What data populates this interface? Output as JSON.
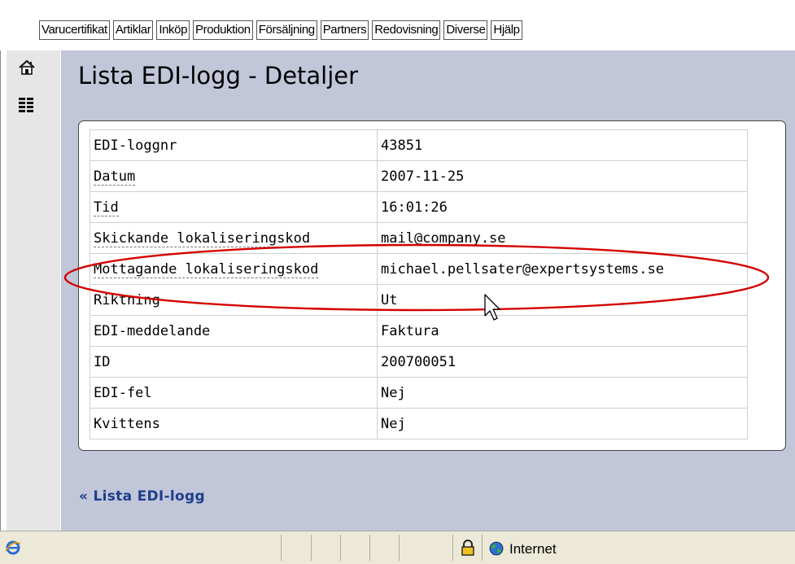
{
  "menu": {
    "items": [
      "Varucertifikat",
      "Artiklar",
      "Inköp",
      "Produktion",
      "Försäljning",
      "Partners",
      "Redovisning",
      "Diverse",
      "Hjälp"
    ]
  },
  "page": {
    "title": "Lista EDI-logg - Detaljer"
  },
  "details": {
    "rows": [
      {
        "label": "EDI-loggnr",
        "value": "43851"
      },
      {
        "label": "Datum",
        "value": "2007-11-25"
      },
      {
        "label": "Tid",
        "value": "16:01:26"
      },
      {
        "label": "Skickande lokaliseringskod",
        "value": "mail@company.se"
      },
      {
        "label": "Mottagande lokaliseringskod",
        "value": "michael.pellsater@expertsystems.se"
      },
      {
        "label": "Riktning",
        "value": "Ut"
      },
      {
        "label": "EDI-meddelande",
        "value": "Faktura"
      },
      {
        "label": "ID",
        "value": "200700051"
      },
      {
        "label": "EDI-fel",
        "value": "Nej"
      },
      {
        "label": "Kvittens",
        "value": "Nej"
      }
    ]
  },
  "back_link": {
    "label": "« Lista EDI-logg"
  },
  "statusbar": {
    "zone": "Internet"
  },
  "colors": {
    "main_bg": "#c1c6d9",
    "link": "#1e3f8a",
    "highlight": "#d40000"
  },
  "icons": {
    "home": "home-icon",
    "list": "list-icon",
    "lock": "lock-icon",
    "globe": "globe-icon",
    "ie": "ie-icon"
  }
}
